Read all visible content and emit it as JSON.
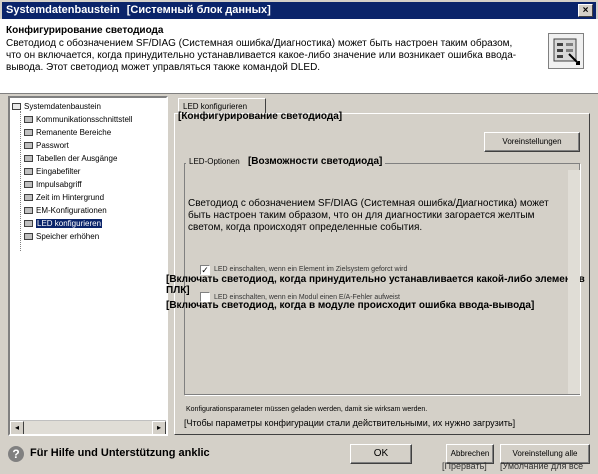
{
  "window": {
    "title_orig": "Systemdatenbaustein",
    "title_trans": "[Системный блок данных]",
    "close_glyph": "×"
  },
  "header": {
    "title": "Конфигурирование светодиода",
    "description": "Светодиод с обозначением SF/DIAG (Системная ошибка/Диагностика) может быть настроен таким образом, что он включается, когда принудительно устанавливается какое-либо значение или возникает ошибка ввода-вывода. Этот светодиод может управляться также командой DLED.",
    "icon": "led-config-icon"
  },
  "tree": {
    "items": [
      {
        "label": "Systemdatenbaustein",
        "icon": "block-icon",
        "root": true
      },
      {
        "label": "Kommunikationsschnittstell",
        "icon": "block-icon"
      },
      {
        "label": "Remanente Bereiche",
        "icon": "block-icon"
      },
      {
        "label": "Passwort",
        "icon": "block-icon"
      },
      {
        "label": "Tabellen der Ausgänge",
        "icon": "block-icon"
      },
      {
        "label": "Eingabefilter",
        "icon": "block-icon"
      },
      {
        "label": "Impulsabgriff",
        "icon": "block-icon"
      },
      {
        "label": "Zeit im Hintergrund",
        "icon": "block-icon"
      },
      {
        "label": "EM-Konfigurationen",
        "icon": "block-icon"
      },
      {
        "label": "LED konfigurieren",
        "icon": "block-icon",
        "selected": true
      },
      {
        "label": "Speicher erhöhen",
        "icon": "block-icon"
      }
    ],
    "scroll_left": "◂",
    "scroll_right": "▸"
  },
  "tab": {
    "label_orig": "LED konfigurieren",
    "label_trans": "[Конфигурирование светодиода]"
  },
  "defaults_button": "Voreinstellungen",
  "group": {
    "legend_orig": "LED-Optionen",
    "legend_trans": "[Возможности светодиода]",
    "description": "Светодиод с обозначением SF/DIAG (Системная ошибка/Диагностика) может быть настроен таким образом, что он для диагностики загорается желтым светом, когда происходят определенные события.",
    "options": [
      {
        "checked": true,
        "label_orig": "LED einschalten, wenn ein Element im Zielsystem geforct wird",
        "label_trans": "[Включать светодиод, когда принудительно устанавливается какой-либо элемент в ПЛК]"
      },
      {
        "checked": false,
        "label_orig": "LED einschalten, wenn ein Modul einen E/A-Fehler aufweist",
        "label_trans": "[Включать светодиод, когда в модуле происходит ошибка ввода-вывода]"
      }
    ]
  },
  "note": {
    "orig": "Konfigurationsparameter müssen geladen werden, damit sie wirksam werden.",
    "trans": "[Чтобы параметры конфигурации стали действительными, их нужно загрузить]"
  },
  "bottom": {
    "help_glyph": "?",
    "help_text": "Für Hilfe und Unterstützung anklic",
    "ok": "OK",
    "cancel": "Abbrechen",
    "cancel_trans": "[Прервать]",
    "defaults_all": "Voreinstellung alle",
    "defaults_all_trans": "[Умолчание для все"
  }
}
